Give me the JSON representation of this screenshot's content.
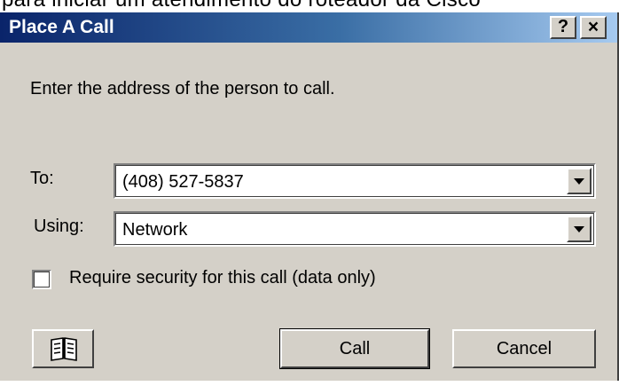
{
  "caption": {
    "text": "para iniciar um atendimento do roteador da Cisco"
  },
  "dialog": {
    "title": "Place A Call",
    "help_button": "?",
    "close_button": "×"
  },
  "body": {
    "instruction": "Enter the address of the person to call.",
    "to_label": "To:",
    "to_value": "(408) 527-5837",
    "using_label": "Using:",
    "using_value": "Network",
    "security_checkbox_label": "Require security for this call (data only)",
    "security_checked": false
  },
  "buttons": {
    "address_book_icon": "address-book-icon",
    "call_label": "Call",
    "cancel_label": "Cancel"
  },
  "colors": {
    "dialog_face": "#d4d0c8",
    "title_start": "#0a246a",
    "title_end": "#a6caf0"
  }
}
